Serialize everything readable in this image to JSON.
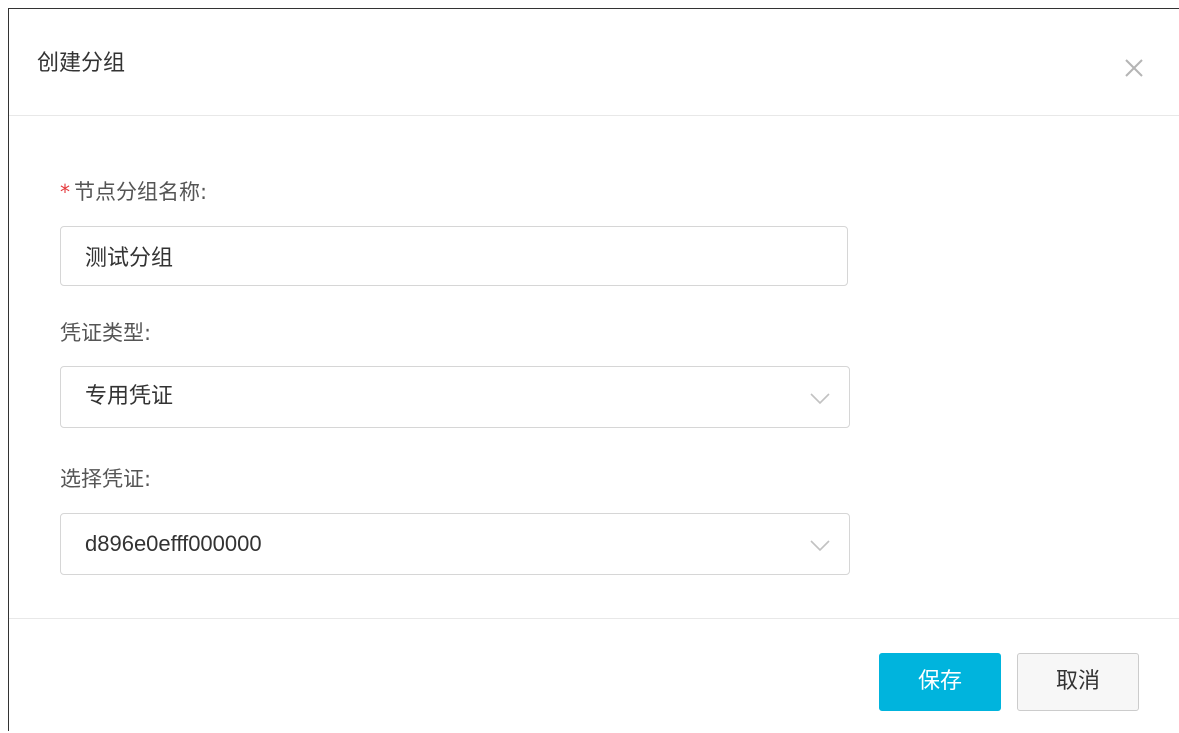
{
  "dialog": {
    "title": "创建分组",
    "close_icon": "close-icon"
  },
  "form": {
    "group_name": {
      "required_mark": "*",
      "label": "节点分组名称:",
      "value": "测试分组"
    },
    "credential_type": {
      "label": "凭证类型:",
      "selected": "专用凭证",
      "icon": "chevron-down-icon"
    },
    "credential": {
      "label": "选择凭证:",
      "selected": "d896e0efff000000",
      "icon": "chevron-down-icon"
    }
  },
  "footer": {
    "save_label": "保存",
    "cancel_label": "取消"
  },
  "colors": {
    "primary": "#00b4dd",
    "required": "#e4393c",
    "border": "#d6d6d6"
  }
}
